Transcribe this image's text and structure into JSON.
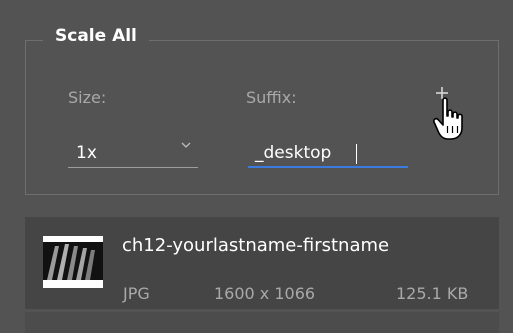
{
  "scale_all": {
    "legend": "Scale All",
    "size_label": "Size:",
    "suffix_label": "Suffix:",
    "size_value": "1x",
    "suffix_value": "_desktop",
    "add_icon": "plus-icon"
  },
  "asset": {
    "name": "ch12-yourlastname-firstname",
    "format": "JPG",
    "dimensions": "1600 x 1066",
    "file_size": "125.1 KB"
  }
}
